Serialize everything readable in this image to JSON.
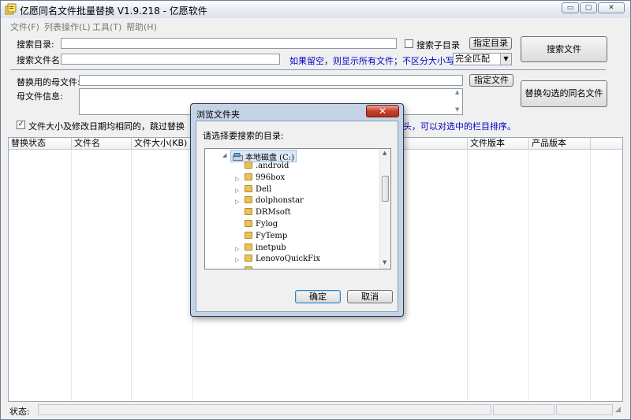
{
  "window": {
    "title": "亿愿同名文件批量替换 V1.9.218 - 亿愿软件",
    "min": "▭",
    "max": "▢",
    "close": "✕"
  },
  "menu": [
    "文件(F)",
    "列表操作(L)",
    "工具(T)",
    "帮助(H)"
  ],
  "search": {
    "dir_label": "搜索目录:",
    "dir_value": "",
    "subdir_label": "搜索子目录",
    "subdir_checked": false,
    "choose_dir_button": "指定目录",
    "name_label": "搜索文件名:",
    "name_value": "",
    "hint": "如果留空，则显示所有文件；不区分大小写",
    "match_mode": "完全匹配",
    "search_button": "搜索文件"
  },
  "replace": {
    "parent_label": "替换用的母文件:",
    "parent_value": "",
    "choose_file_button": "指定文件",
    "info_label": "母文件信息:",
    "info_value": "",
    "replace_button": "替换勾选的同名文件"
  },
  "options": {
    "skip_label": "文件大小及修改日期均相同的，跳过替换",
    "skip_checked": true,
    "sort_hint": "头，可以对选中的栏目排序。"
  },
  "table": {
    "columns": [
      "替换状态",
      "文件名",
      "文件大小(KB)",
      "",
      "",
      "文件版本",
      "产品版本",
      ""
    ],
    "rows": []
  },
  "status": {
    "label": "状态:",
    "value": ""
  },
  "dialog": {
    "title": "浏览文件夹",
    "close": "✕",
    "prompt": "请选择要搜索的目录:",
    "root": "本地磁盘 (C:)",
    "folders": [
      {
        "name": ".android",
        "expandable": false
      },
      {
        "name": "996box",
        "expandable": true
      },
      {
        "name": "Dell",
        "expandable": true
      },
      {
        "name": "dolphonstar",
        "expandable": true
      },
      {
        "name": "DRMsoft",
        "expandable": false
      },
      {
        "name": "Fylog",
        "expandable": false
      },
      {
        "name": "FyTemp",
        "expandable": false
      },
      {
        "name": "inetpub",
        "expandable": true
      },
      {
        "name": "LenovoQuickFix",
        "expandable": true
      },
      {
        "name": "",
        "expandable": false
      }
    ],
    "ok_button": "确定",
    "cancel_button": "取消"
  },
  "colors": {
    "accent_text": "#0000c8",
    "close_button": "#c7402a",
    "folder": "#e8c25a"
  }
}
